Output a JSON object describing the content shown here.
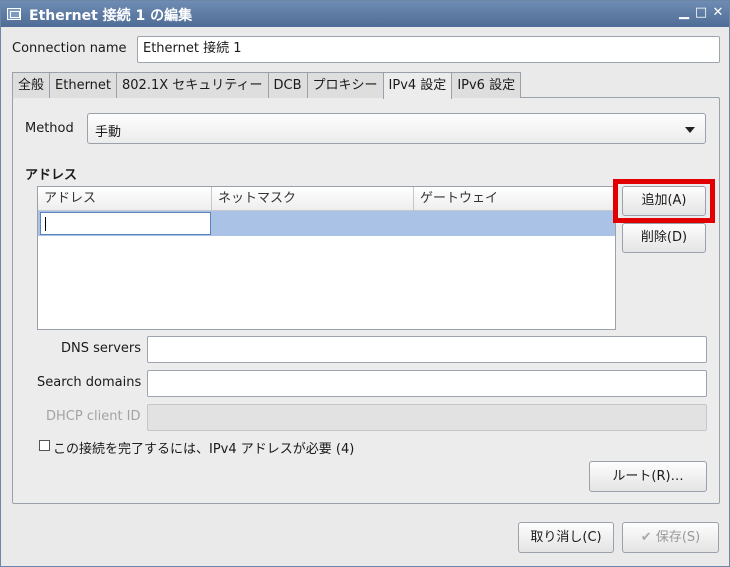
{
  "window": {
    "title": "Ethernet 接続 1 の編集",
    "controls": {
      "minimize": "▁",
      "maximize": "□",
      "close": "✕"
    }
  },
  "connection_name": {
    "label": "Connection name",
    "value": "Ethernet 接続 1"
  },
  "tabs": [
    {
      "label": "全般",
      "active": false
    },
    {
      "label": "Ethernet",
      "active": false
    },
    {
      "label": "802.1X セキュリティー",
      "active": false
    },
    {
      "label": "DCB",
      "active": false
    },
    {
      "label": "プロキシー",
      "active": false
    },
    {
      "label": "IPv4 設定",
      "active": true
    },
    {
      "label": "IPv6 設定",
      "active": false
    }
  ],
  "ipv4": {
    "method_label": "Method",
    "method_value": "手動",
    "addresses_heading": "アドレス",
    "columns": [
      "アドレス",
      "ネットマスク",
      "ゲートウェイ"
    ],
    "add_button": "追加(A)",
    "delete_button": "削除(D)",
    "dns_label": "DNS servers",
    "dns_value": "",
    "search_label": "Search domains",
    "search_value": "",
    "dhcp_label": "DHCP client ID",
    "dhcp_value": "",
    "require_checkbox_label": "この接続を完了するには、IPv4 アドレスが必要 (4)",
    "require_checked": false,
    "routes_button": "ルート(R)…"
  },
  "footer": {
    "cancel_button": "取り消し(C)",
    "save_button": "保存(S)",
    "save_icon": "checkmark-icon"
  },
  "colors": {
    "highlight": "#e00000",
    "selected_row": "#a9c2e5",
    "titlebar": "#5a7aa3"
  }
}
